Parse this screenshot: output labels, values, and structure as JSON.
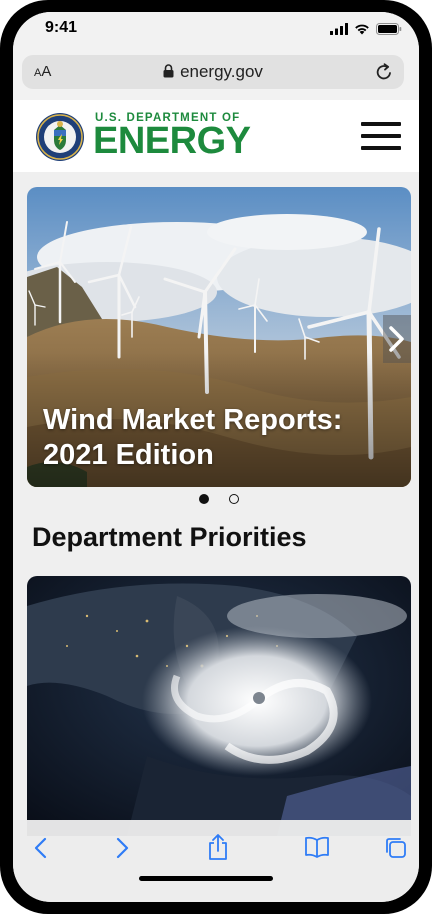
{
  "status": {
    "time": "9:41"
  },
  "browser": {
    "text_size_label_small": "A",
    "text_size_label_large": "A",
    "url": "energy.gov"
  },
  "site": {
    "logo_line1": "U.S. DEPARTMENT OF",
    "logo_line2": "ENERGY"
  },
  "hero": {
    "title": "Wind Market Reports: 2021 Edition",
    "slides_total": 2,
    "active_slide": 1
  },
  "section": {
    "title": "Department Priorities"
  },
  "colors": {
    "brand_green": "#1d8a3d",
    "ios_blue": "#2f7cf6"
  },
  "icons": [
    "lock-icon",
    "reload-icon",
    "menu-icon",
    "chevron-right-icon",
    "back-icon",
    "forward-icon",
    "share-icon",
    "bookmarks-icon",
    "tabs-icon"
  ]
}
